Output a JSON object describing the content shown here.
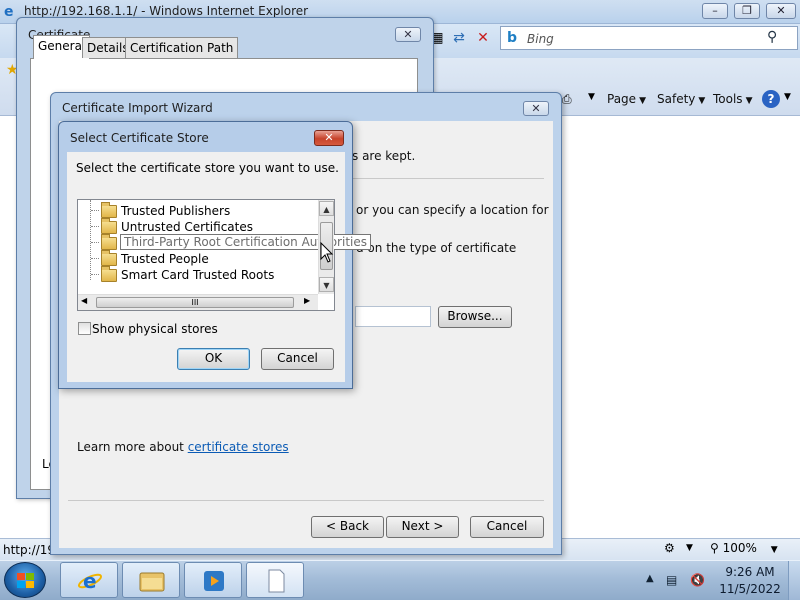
{
  "ie": {
    "title": "http://192.168.1.1/ - Windows Internet Explorer",
    "search_placeholder": "Bing",
    "commands": {
      "page": "Page",
      "safety": "Safety",
      "tools": "Tools"
    },
    "status_url": "http://19",
    "zoom": "100%"
  },
  "certificate": {
    "title": "Certificate",
    "tabs": [
      "General",
      "Details",
      "Certification Path"
    ],
    "partial_text": "Le"
  },
  "wizard": {
    "title": "Certificate Import Wizard",
    "partial_lines": [
      "s are kept.",
      "or you can specify a location for",
      "d on the type of certificate"
    ],
    "browse": "Browse...",
    "learn_prefix": "Learn more about ",
    "learn_link": "certificate stores",
    "back": "< Back",
    "next": "Next >",
    "cancel": "Cancel"
  },
  "store_dialog": {
    "title": "Select Certificate Store",
    "instruction": "Select the certificate store you want to use.",
    "items": [
      "Trusted Publishers",
      "Untrusted Certificates",
      "Third-Party Root Certification Authorities",
      "Trusted People",
      "Smart Card Trusted Roots"
    ],
    "hscroll_grip": "III",
    "show_physical": "Show physical stores",
    "show_physical_checked": false,
    "ok": "OK",
    "cancel": "Cancel"
  },
  "taskbar": {
    "time": "9:26 AM",
    "date": "11/5/2022"
  }
}
